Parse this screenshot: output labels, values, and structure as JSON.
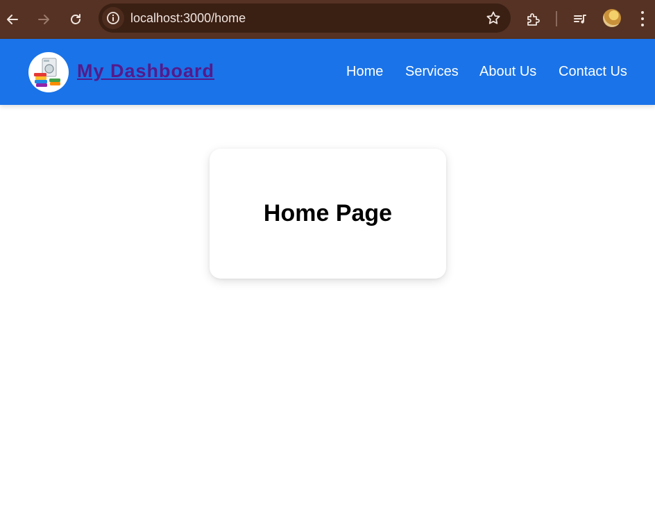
{
  "browser": {
    "url": "localhost:3000/home",
    "chrome_color": "#553223",
    "icons": [
      "back-icon",
      "forward-icon",
      "reload-icon",
      "site-info-icon",
      "bookmark-star-icon",
      "extensions-icon",
      "media-controls-icon",
      "profile-avatar",
      "more-menu-icon"
    ]
  },
  "navbar": {
    "brand": "My Dashboard",
    "background": "#1a73e8",
    "links": [
      {
        "label": "Home"
      },
      {
        "label": "Services"
      },
      {
        "label": "About Us"
      },
      {
        "label": "Contact Us"
      }
    ]
  },
  "main": {
    "card_title": "Home Page"
  }
}
